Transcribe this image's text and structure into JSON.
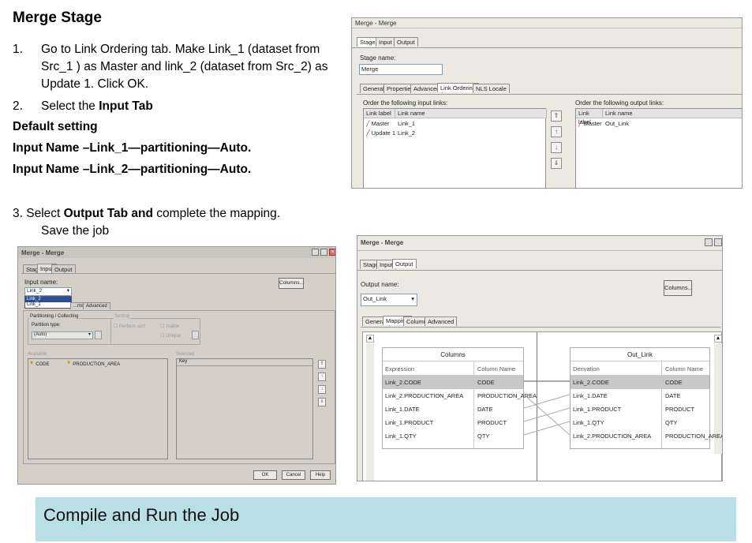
{
  "slide": {
    "title": "Merge Stage",
    "steps": [
      {
        "num": "1.",
        "text": "Go to Link Ordering tab.  Make Link_1 (dataset from Src_1 ) as Master and link_2 (dataset from Src_2) as Update 1.  Click OK."
      },
      {
        "num": "2.",
        "text_pre": "Select the ",
        "text_bold": "Input Tab"
      }
    ],
    "default_setting": "Default setting",
    "input_line_1": "Input Name –Link_1—partitioning—Auto.",
    "input_line_2": "Input Name –Link_2—partitioning—Auto.",
    "step3": {
      "pre": "3. Select ",
      "bold": "Output Tab and",
      "post": " complete the mapping."
    },
    "step3_line2": "Save the job",
    "banner": "Compile and Run the Job"
  },
  "win1": {
    "title": "Merge - Merge",
    "tabs": [
      "Stage",
      "Input",
      "Output"
    ],
    "stage_name_label": "Stage name:",
    "stage_name_value": "Merge",
    "subtabs": [
      "General",
      "Properties",
      "Advanced",
      "Link Ordering",
      "NLS Locale"
    ],
    "input_links_label": "Order the following input links:",
    "output_links_label": "Order the following output links:",
    "col_link_label": "Link label",
    "col_link_name": "Link name",
    "input_rows": [
      {
        "label": "Master",
        "name": "Link_1"
      },
      {
        "label": "Update 1",
        "name": "Link_2"
      }
    ],
    "output_rows": [
      {
        "label": "Master",
        "name": "Out_Link"
      }
    ]
  },
  "win2": {
    "title": "Merge - Merge",
    "tabs": [
      "Stage",
      "Input",
      "Output"
    ],
    "input_name_label": "Input name:",
    "input_name_value": "Link_2",
    "dropdown_options": [
      "Link_2",
      "Link_1"
    ],
    "columns_button": "Columns...",
    "subtabs": [
      "...ms",
      "Advanced"
    ],
    "partitioning_label": "Partitioning / Collecting",
    "partition_type_label": "Partition type:",
    "partition_type_value": "(Auto)",
    "sorting_label": "Sorting",
    "perform_sort": "Perform sort",
    "stable": "Stable",
    "unique": "Unique",
    "available_label": "Available",
    "selected_label": "Selected",
    "available_items": [
      "CODE",
      "PRODUCTION_AREA"
    ],
    "selected_header": "Key",
    "ok": "OK",
    "cancel": "Cancel",
    "help": "Help"
  },
  "win3": {
    "title": "Merge - Merge",
    "tabs": [
      "Stage",
      "Input",
      "Output"
    ],
    "output_name_label": "Output name:",
    "output_name_value": "Out_Link",
    "columns_button": "Columns...",
    "subtabs": [
      "General",
      "Mapping",
      "Columns",
      "Advanced"
    ],
    "left_table": {
      "title": "Columns",
      "headers": [
        "Expression",
        "Column Name"
      ],
      "rows": [
        [
          "Link_2.CODE",
          "CODE"
        ],
        [
          "Link_2.PRODUCTION_AREA",
          "PRODUCTION_AREA"
        ],
        [
          "Link_1.DATE",
          "DATE"
        ],
        [
          "Link_1.PRODUCT",
          "PRODUCT"
        ],
        [
          "Link_1.QTY",
          "QTY"
        ]
      ]
    },
    "right_table": {
      "title": "Out_Link",
      "headers": [
        "Derivation",
        "Column Name"
      ],
      "rows": [
        [
          "Link_2.CODE",
          "CODE"
        ],
        [
          "Link_1.DATE",
          "DATE"
        ],
        [
          "Link_1.PRODUCT",
          "PRODUCT"
        ],
        [
          "Link_1.QTY",
          "QTY"
        ],
        [
          "Link_2.PRODUCTION_AREA",
          "PRODUCTION_AREA"
        ]
      ]
    }
  }
}
